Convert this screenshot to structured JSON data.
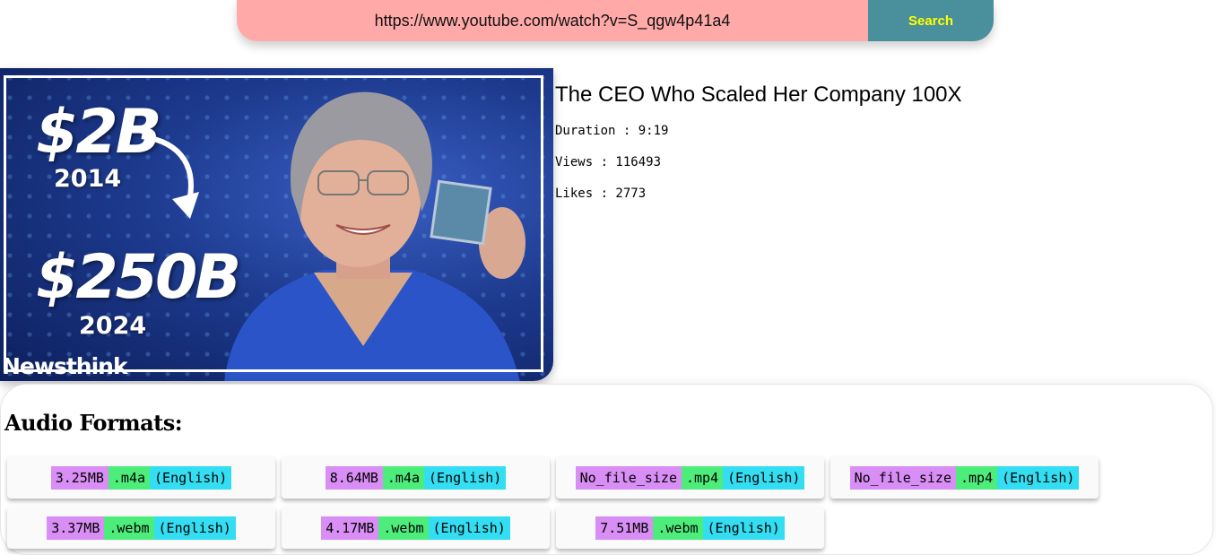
{
  "search": {
    "url_value": "https://www.youtube.com/watch?v=S_qgw4p41a4",
    "button_label": "Search",
    "accent_color": "#4a8f9c",
    "input_color": "#ffaaa8"
  },
  "thumbnail": {
    "value_top": "$2B",
    "year_top": "2014",
    "value_bottom": "$250B",
    "year_bottom": "2024",
    "brand": "Newsthink"
  },
  "video": {
    "title": "The CEO Who Scaled Her Company 100X",
    "duration": "Duration : 9:19",
    "views": "Views : 116493",
    "likes": "Likes : 2773"
  },
  "audio_formats": {
    "heading": "Audio Formats:",
    "items": [
      {
        "size": "3.25MB",
        "ext": ".m4a",
        "lang": "(English)"
      },
      {
        "size": "8.64MB",
        "ext": ".m4a",
        "lang": "(English)"
      },
      {
        "size": "No_file_size",
        "ext": ".mp4",
        "lang": "(English)"
      },
      {
        "size": "No_file_size",
        "ext": ".mp4",
        "lang": "(English)"
      },
      {
        "size": "3.37MB",
        "ext": ".webm",
        "lang": "(English)"
      },
      {
        "size": "4.17MB",
        "ext": ".webm",
        "lang": "(English)"
      },
      {
        "size": "7.51MB",
        "ext": ".webm",
        "lang": "(English)"
      }
    ],
    "colors": {
      "size": "#d98ef5",
      "ext": "#4ded7c",
      "lang": "#33def2"
    }
  }
}
